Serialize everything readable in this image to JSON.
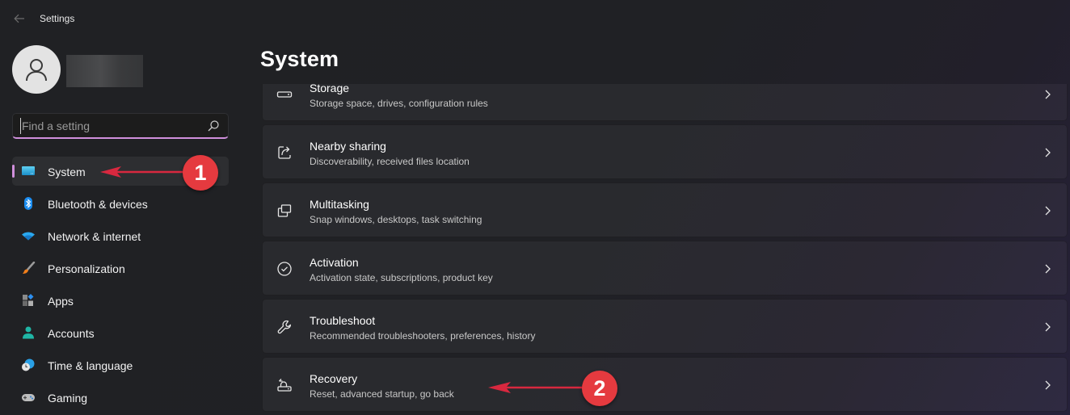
{
  "window": {
    "title": "Settings",
    "back_icon": "arrow-left-icon"
  },
  "profile": {
    "avatar_icon": "person-icon",
    "name": ""
  },
  "search": {
    "placeholder": "Find a setting",
    "value": "",
    "icon": "search-icon"
  },
  "sidebar": {
    "accent_color": "#d08fdc",
    "items": [
      {
        "label": "System",
        "icon": "monitor-icon",
        "active": true
      },
      {
        "label": "Bluetooth & devices",
        "icon": "bluetooth-icon",
        "active": false
      },
      {
        "label": "Network & internet",
        "icon": "wifi-icon",
        "active": false
      },
      {
        "label": "Personalization",
        "icon": "paintbrush-icon",
        "active": false
      },
      {
        "label": "Apps",
        "icon": "apps-icon",
        "active": false
      },
      {
        "label": "Accounts",
        "icon": "account-icon",
        "active": false
      },
      {
        "label": "Time & language",
        "icon": "globe-clock-icon",
        "active": false
      },
      {
        "label": "Gaming",
        "icon": "gamepad-icon",
        "active": false
      }
    ]
  },
  "main": {
    "title": "System",
    "cards": [
      {
        "title": "Storage",
        "subtitle": "Storage space, drives, configuration rules",
        "icon": "drive-icon"
      },
      {
        "title": "Nearby sharing",
        "subtitle": "Discoverability, received files location",
        "icon": "share-icon"
      },
      {
        "title": "Multitasking",
        "subtitle": "Snap windows, desktops, task switching",
        "icon": "multitask-icon"
      },
      {
        "title": "Activation",
        "subtitle": "Activation state, subscriptions, product key",
        "icon": "check-circle-icon"
      },
      {
        "title": "Troubleshoot",
        "subtitle": "Recommended troubleshooters, preferences, history",
        "icon": "wrench-icon"
      },
      {
        "title": "Recovery",
        "subtitle": "Reset, advanced startup, go back",
        "icon": "recovery-icon"
      }
    ]
  },
  "annotations": {
    "color": "#e53a3f",
    "steps": [
      {
        "number": "1",
        "target": "System"
      },
      {
        "number": "2",
        "target": "Recovery"
      }
    ]
  }
}
